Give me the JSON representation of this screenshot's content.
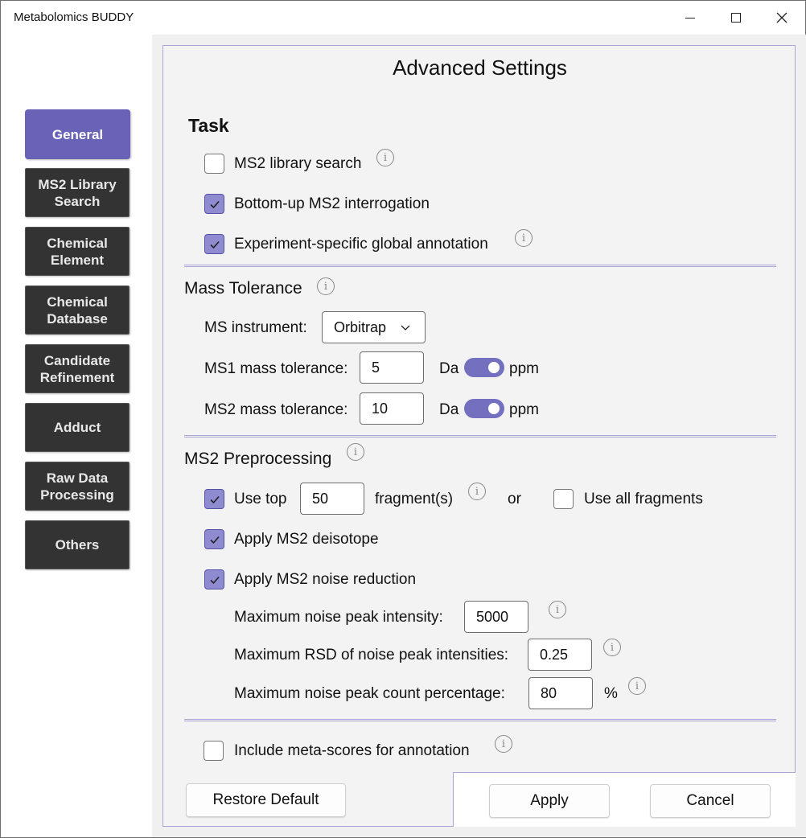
{
  "window": {
    "title": "Metabolomics BUDDY",
    "controls": {
      "minimize": "minimize-icon",
      "maximize": "maximize-icon",
      "close": "close-icon"
    }
  },
  "sidebar": {
    "items": [
      {
        "label": "General",
        "active": true
      },
      {
        "label": "MS2 Library Search"
      },
      {
        "label": "Chemical Element"
      },
      {
        "label": "Chemical Database"
      },
      {
        "label": "Candidate Refinement"
      },
      {
        "label": "Adduct"
      },
      {
        "label": "Raw Data Processing"
      },
      {
        "label": "Others"
      }
    ]
  },
  "panel": {
    "heading": "Advanced Settings",
    "task": {
      "title": "Task",
      "options": [
        {
          "label": "MS2 library search",
          "checked": false,
          "info": true
        },
        {
          "label": "Bottom-up MS2 interrogation",
          "checked": true,
          "info": false
        },
        {
          "label": "Experiment-specific global annotation",
          "checked": true,
          "info": true
        }
      ]
    },
    "mass_tolerance": {
      "title": "Mass Tolerance",
      "instrument_label": "MS instrument:",
      "instrument_value": "Orbitrap",
      "ms1_label": "MS1 mass tolerance:",
      "ms1_value": "5",
      "ms2_label": "MS2 mass tolerance:",
      "ms2_value": "10",
      "unit_left": "Da",
      "unit_right": "ppm"
    },
    "ms2_preprocessing": {
      "title": "MS2 Preprocessing",
      "use_top_label": "Use top",
      "use_top_value": "50",
      "fragments_label": "fragment(s)",
      "or_label": "or",
      "use_all_label": "Use all fragments",
      "deisotope_label": "Apply MS2 deisotope",
      "noise_reduction_label": "Apply MS2 noise reduction",
      "max_noise_intensity_label": "Maximum noise peak intensity:",
      "max_noise_intensity_value": "5000",
      "max_rsd_label": "Maximum RSD of noise peak intensities:",
      "max_rsd_value": "0.25",
      "max_count_label": "Maximum noise peak count percentage:",
      "max_count_value": "80",
      "percent_unit": "%"
    },
    "meta_scores_label": "Include meta-scores for annotation",
    "info_glyph": "i"
  },
  "footer": {
    "restore_label": "Restore Default",
    "apply_label": "Apply",
    "cancel_label": "Cancel"
  },
  "colors": {
    "accent": "#6a62b7",
    "checkbox_checked": "#8e8bd1",
    "toggle": "#7370c0",
    "nav_button": "#333333"
  }
}
